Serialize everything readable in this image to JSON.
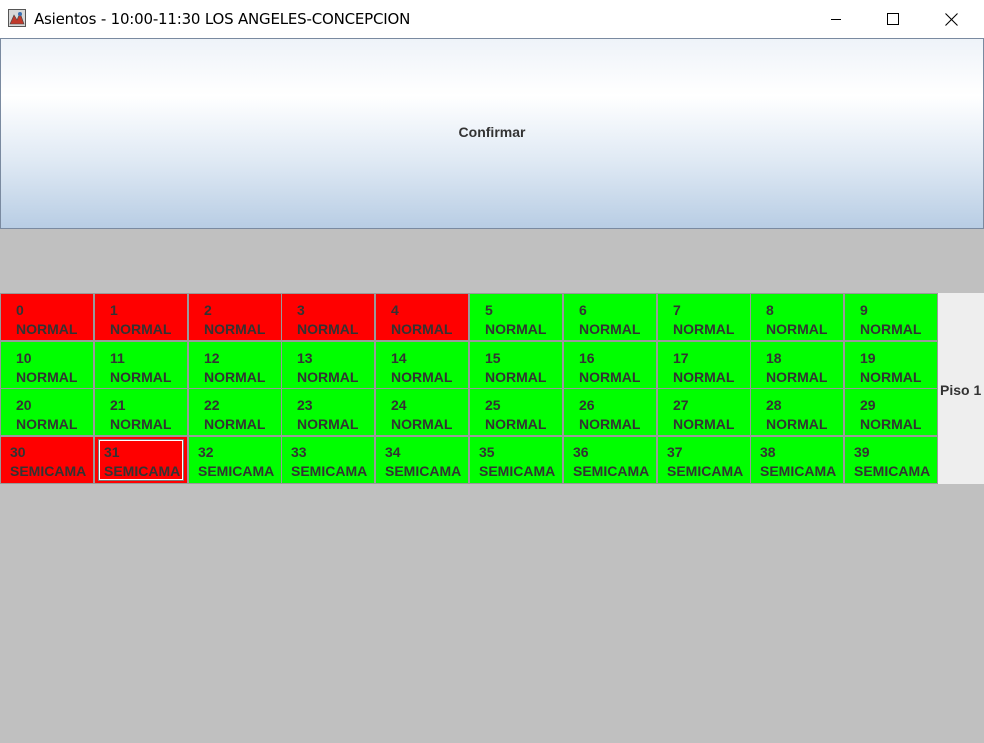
{
  "window": {
    "title": "Asientos - 10:00-11:30 LOS ANGELES-CONCEPCION",
    "controls": [
      "minimize",
      "maximize",
      "close"
    ]
  },
  "confirm_button": {
    "label": "Confirmar"
  },
  "floor": {
    "label": "Piso 1"
  },
  "colors": {
    "free": "#00ff00",
    "taken": "#ff0000",
    "background": "#c0c0c0"
  },
  "seats": [
    {
      "number": "0",
      "type": "NORMAL",
      "status": "taken"
    },
    {
      "number": "1",
      "type": "NORMAL",
      "status": "taken"
    },
    {
      "number": "2",
      "type": "NORMAL",
      "status": "taken"
    },
    {
      "number": "3",
      "type": "NORMAL",
      "status": "taken"
    },
    {
      "number": "4",
      "type": "NORMAL",
      "status": "taken"
    },
    {
      "number": "5",
      "type": "NORMAL",
      "status": "free"
    },
    {
      "number": "6",
      "type": "NORMAL",
      "status": "free"
    },
    {
      "number": "7",
      "type": "NORMAL",
      "status": "free"
    },
    {
      "number": "8",
      "type": "NORMAL",
      "status": "free"
    },
    {
      "number": "9",
      "type": "NORMAL",
      "status": "free"
    },
    {
      "number": "10",
      "type": "NORMAL",
      "status": "free"
    },
    {
      "number": "11",
      "type": "NORMAL",
      "status": "free"
    },
    {
      "number": "12",
      "type": "NORMAL",
      "status": "free"
    },
    {
      "number": "13",
      "type": "NORMAL",
      "status": "free"
    },
    {
      "number": "14",
      "type": "NORMAL",
      "status": "free"
    },
    {
      "number": "15",
      "type": "NORMAL",
      "status": "free"
    },
    {
      "number": "16",
      "type": "NORMAL",
      "status": "free"
    },
    {
      "number": "17",
      "type": "NORMAL",
      "status": "free"
    },
    {
      "number": "18",
      "type": "NORMAL",
      "status": "free"
    },
    {
      "number": "19",
      "type": "NORMAL",
      "status": "free"
    },
    {
      "number": "20",
      "type": "NORMAL",
      "status": "free"
    },
    {
      "number": "21",
      "type": "NORMAL",
      "status": "free"
    },
    {
      "number": "22",
      "type": "NORMAL",
      "status": "free"
    },
    {
      "number": "23",
      "type": "NORMAL",
      "status": "free"
    },
    {
      "number": "24",
      "type": "NORMAL",
      "status": "free"
    },
    {
      "number": "25",
      "type": "NORMAL",
      "status": "free"
    },
    {
      "number": "26",
      "type": "NORMAL",
      "status": "free"
    },
    {
      "number": "27",
      "type": "NORMAL",
      "status": "free"
    },
    {
      "number": "28",
      "type": "NORMAL",
      "status": "free"
    },
    {
      "number": "29",
      "type": "NORMAL",
      "status": "free"
    },
    {
      "number": "30",
      "type": "SEMICAMA",
      "status": "taken"
    },
    {
      "number": "31",
      "type": "SEMICAMA",
      "status": "taken",
      "focused": true
    },
    {
      "number": "32",
      "type": "SEMICAMA",
      "status": "free"
    },
    {
      "number": "33",
      "type": "SEMICAMA",
      "status": "free"
    },
    {
      "number": "34",
      "type": "SEMICAMA",
      "status": "free"
    },
    {
      "number": "35",
      "type": "SEMICAMA",
      "status": "free"
    },
    {
      "number": "36",
      "type": "SEMICAMA",
      "status": "free"
    },
    {
      "number": "37",
      "type": "SEMICAMA",
      "status": "free"
    },
    {
      "number": "38",
      "type": "SEMICAMA",
      "status": "free"
    },
    {
      "number": "39",
      "type": "SEMICAMA",
      "status": "free"
    }
  ]
}
